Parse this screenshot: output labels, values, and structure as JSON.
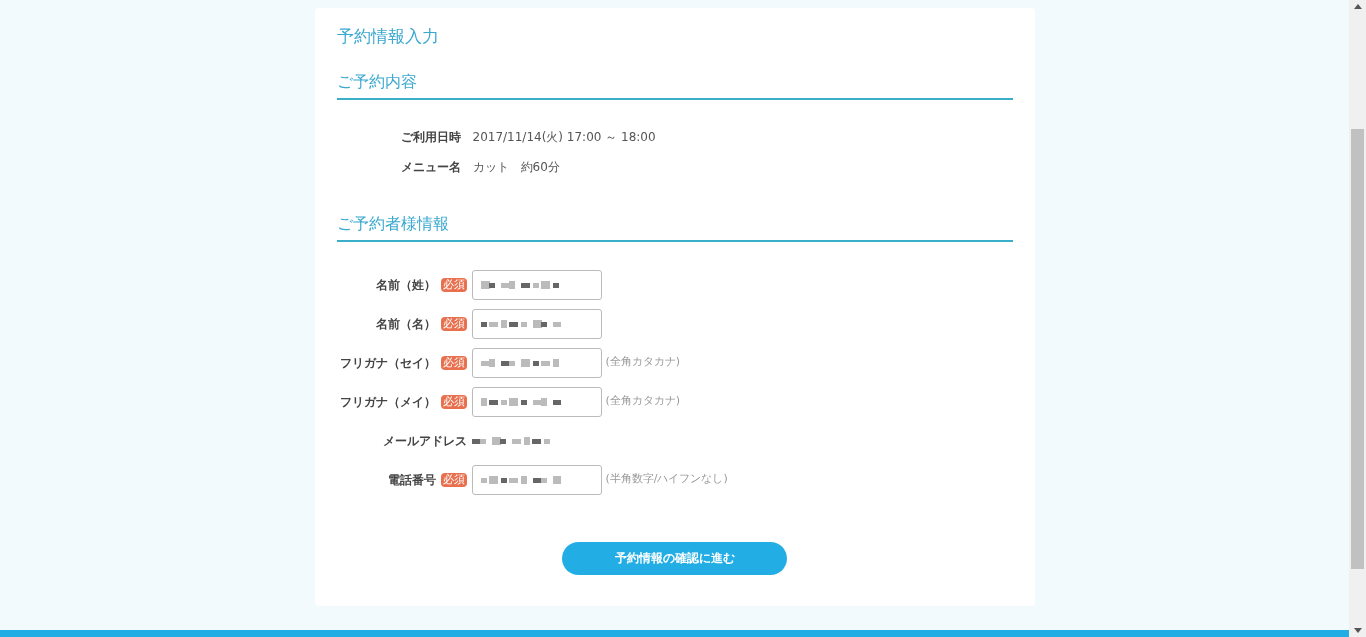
{
  "page_title": "予約情報入力",
  "sections": [
    {
      "heading": "ご予約内容"
    },
    {
      "heading": "ご予約者様情報"
    }
  ],
  "details": [
    {
      "label": "ご利用日時",
      "value": "2017/11/14(火) 17:00 ～ 18:00"
    },
    {
      "label": "メニュー名",
      "value": "カット　約60分"
    }
  ],
  "fields": [
    {
      "kind": "input",
      "label": "名前（姓）",
      "badge": "必須"
    },
    {
      "kind": "input",
      "label": "名前（名）",
      "badge": "必須"
    },
    {
      "kind": "input",
      "label": "フリガナ（セイ）",
      "badge": "必須",
      "hint": "(全角カタカナ)"
    },
    {
      "kind": "input",
      "label": "フリガナ（メイ）",
      "badge": "必須",
      "hint": "(全角カタカナ)"
    },
    {
      "kind": "static",
      "label": "メールアドレス"
    },
    {
      "kind": "input",
      "label": "電話番号",
      "badge": "必須",
      "hint": "(半角数字/ハイフンなし)"
    }
  ],
  "submit": "予約情報の確認に進む"
}
